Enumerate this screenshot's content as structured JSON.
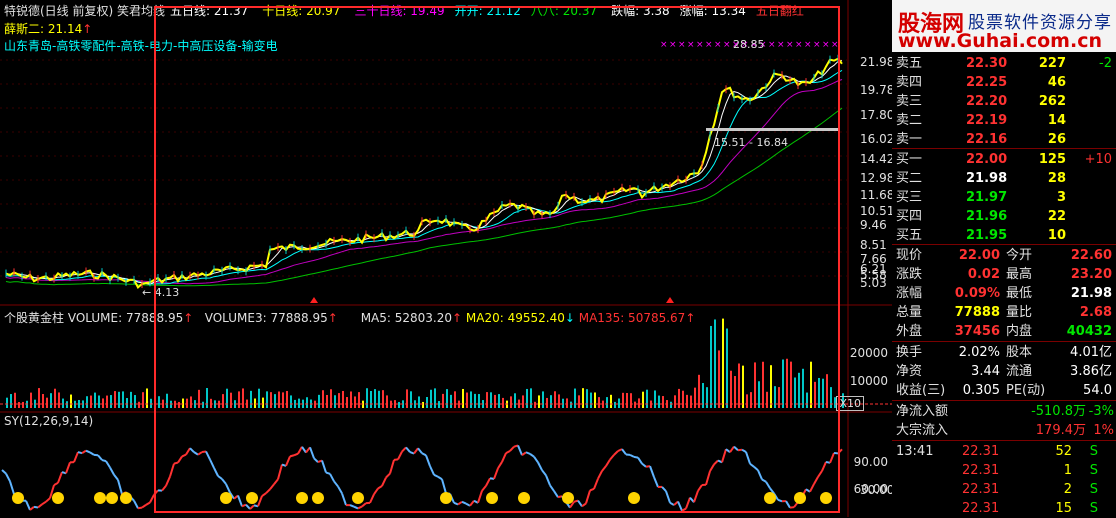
{
  "header": {
    "stock_title": "特锐德(日线 前复权) 笑君均线",
    "ma_items": [
      {
        "label": "五日线: 21.37",
        "color": "#ffffff"
      },
      {
        "label": "十日线: 20.97",
        "color": "#ffff00"
      },
      {
        "label": "三十日线: 19.49",
        "color": "#ff00ff"
      },
      {
        "label": "开开: 21.12",
        "color": "#00ffff"
      },
      {
        "label": "八八: 20.37",
        "color": "#00e600"
      },
      {
        "label": "跌幅: 3.38",
        "color": "#ffffff"
      },
      {
        "label": "涨幅: 13.34",
        "color": "#ffffff"
      },
      {
        "label": "五日翻红",
        "color": "#ff3232"
      }
    ],
    "indicator_label": "薛斯二: 21.14",
    "concept_tags": "山东青岛-高铁零配件-高铁-电力-中高压设备-输变电"
  },
  "price_chart": {
    "high_label": "28.85",
    "low_label": "4.13",
    "range_label": "15.51 - 16.84",
    "y_axis": [
      "21.98",
      "19.78",
      "17.80",
      "16.02",
      "14.42",
      "12.98",
      "11.68",
      "10.51",
      "9.46",
      "8.51",
      "7.66",
      "6.21",
      "5.58",
      "5.03"
    ]
  },
  "volume_panel": {
    "name": "个股黄金柱",
    "volume": "VOLUME: 77888.95",
    "volume3": "VOLUME3: 77888.95",
    "ma5": "MA5: 52803.20",
    "ma20": "MA20: 49552.40",
    "ma135": "MA135: 50785.67",
    "y_axis": [
      "20000",
      "10000"
    ],
    "scale": "X10"
  },
  "sy_panel": {
    "name": "SY(12,26,9,14)",
    "y_axis": [
      "90.00",
      "60.00",
      "30.00"
    ]
  },
  "logo": {
    "name": "股海网",
    "slogan": "股票软件资源分享",
    "url": "www.Guhai.com.cn"
  },
  "order_book": {
    "asks": [
      {
        "label": "卖五",
        "price": "22.30",
        "vol": "227",
        "chg": "-2"
      },
      {
        "label": "卖四",
        "price": "22.25",
        "vol": "46",
        "chg": ""
      },
      {
        "label": "卖三",
        "price": "22.20",
        "vol": "262",
        "chg": ""
      },
      {
        "label": "卖二",
        "price": "22.19",
        "vol": "14",
        "chg": ""
      },
      {
        "label": "卖一",
        "price": "22.16",
        "vol": "26",
        "chg": ""
      }
    ],
    "bids": [
      {
        "label": "买一",
        "price": "22.00",
        "vol": "125",
        "chg": "+10",
        "color": "#ff3232"
      },
      {
        "label": "买二",
        "price": "21.98",
        "vol": "28",
        "chg": "",
        "color": "#ffffff"
      },
      {
        "label": "买三",
        "price": "21.97",
        "vol": "3",
        "chg": "",
        "color": "#00e600"
      },
      {
        "label": "买四",
        "price": "21.96",
        "vol": "22",
        "chg": "",
        "color": "#00e600"
      },
      {
        "label": "买五",
        "price": "21.95",
        "vol": "10",
        "chg": "",
        "color": "#00e600"
      }
    ]
  },
  "quote": {
    "rows": [
      {
        "l1": "现价",
        "v1": "22.00",
        "c1": "#ff3232",
        "l2": "今开",
        "v2": "22.60",
        "c2": "#ff3232"
      },
      {
        "l1": "涨跌",
        "v1": "0.02",
        "c1": "#ff3232",
        "l2": "最高",
        "v2": "23.20",
        "c2": "#ff3232"
      },
      {
        "l1": "涨幅",
        "v1": "0.09%",
        "c1": "#ff3232",
        "l2": "最低",
        "v2": "21.98",
        "c2": "#ffffff"
      },
      {
        "l1": "总量",
        "v1": "77888",
        "c1": "#ffff00",
        "l2": "量比",
        "v2": "2.68",
        "c2": "#ff3232"
      },
      {
        "l1": "外盘",
        "v1": "37456",
        "c1": "#ff3232",
        "l2": "内盘",
        "v2": "40432",
        "c2": "#00e600"
      }
    ],
    "rows2": [
      {
        "l1": "换手",
        "v1": "2.02%",
        "c1": "#ffffff",
        "l2": "股本",
        "v2": "4.01亿",
        "c2": "#ffffff"
      },
      {
        "l1": "净资",
        "v1": "3.44",
        "c1": "#ffffff",
        "l2": "流通",
        "v2": "3.86亿",
        "c2": "#ffffff"
      },
      {
        "l1": "收益(三)",
        "v1": "0.305",
        "c1": "#ffffff",
        "l2": "PE(动)",
        "v2": "54.0",
        "c2": "#ffffff"
      }
    ],
    "flows": [
      {
        "label": "净流入额",
        "value": "-510.8万",
        "pct": "-3%",
        "color": "#00e600"
      },
      {
        "label": "大宗流入",
        "value": "179.4万",
        "pct": "1%",
        "color": "#ff3232"
      }
    ]
  },
  "ticks": [
    {
      "time": "13:41",
      "price": "22.31",
      "vol": "52",
      "side": "S"
    },
    {
      "time": "",
      "price": "22.31",
      "vol": "1",
      "side": "S"
    },
    {
      "time": "",
      "price": "22.31",
      "vol": "2",
      "side": "S"
    },
    {
      "time": "",
      "price": "22.31",
      "vol": "15",
      "side": "S"
    }
  ]
}
